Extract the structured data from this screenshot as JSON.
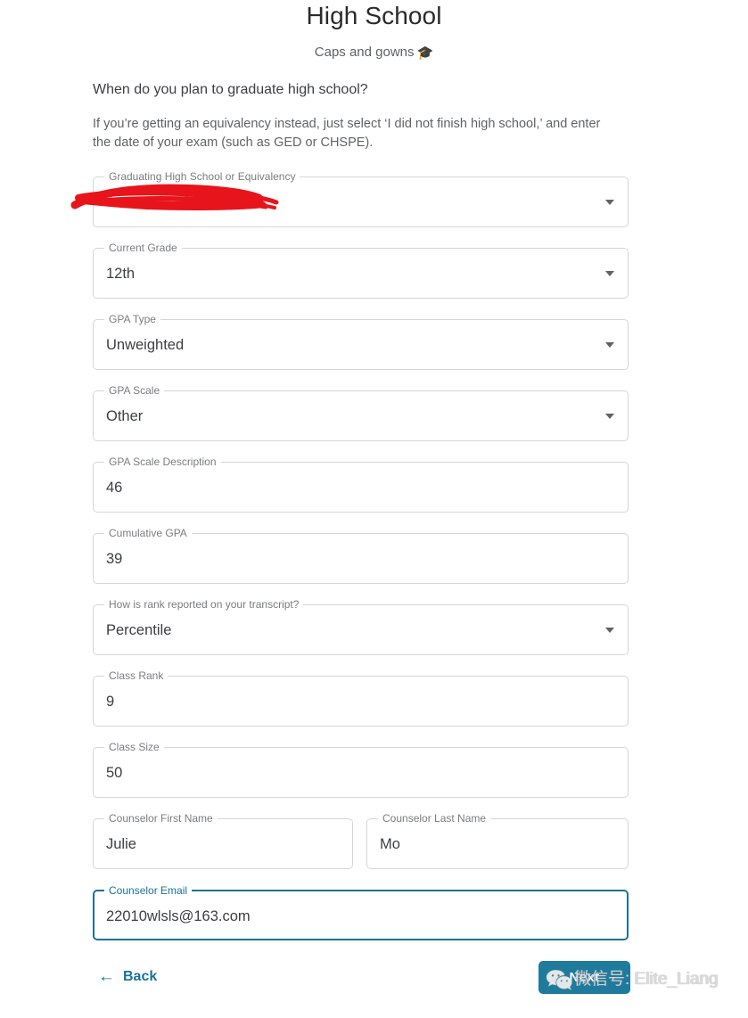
{
  "header": {
    "title": "High School",
    "subtitle": "Caps and gowns",
    "subtitle_emoji": "🎓"
  },
  "intro": {
    "question": "When do you plan to graduate high school?",
    "helper": "If you’re getting an equivalency instead, just select ‘I did not finish high school,’ and enter the date of your exam (such as GED or CHSPE)."
  },
  "fields": {
    "graduating": {
      "label": "Graduating High School or Equivalency",
      "value": "",
      "redacted": true
    },
    "current_grade": {
      "label": "Current Grade",
      "value": "12th"
    },
    "gpa_type": {
      "label": "GPA Type",
      "value": "Unweighted"
    },
    "gpa_scale": {
      "label": "GPA Scale",
      "value": "Other"
    },
    "gpa_scale_description": {
      "label": "GPA Scale Description",
      "value": "46"
    },
    "cumulative_gpa": {
      "label": "Cumulative GPA",
      "value": "39"
    },
    "rank_reported": {
      "label": "How is rank reported on your transcript?",
      "value": "Percentile"
    },
    "class_rank": {
      "label": "Class Rank",
      "value": "9"
    },
    "class_size": {
      "label": "Class Size",
      "value": "50"
    },
    "counselor_first_name": {
      "label": "Counselor First Name",
      "value": "Julie"
    },
    "counselor_last_name": {
      "label": "Counselor Last Name",
      "value": "Mo"
    },
    "counselor_email": {
      "label": "Counselor Email",
      "value": "22010wlsls@163.com",
      "focused": true
    }
  },
  "footer": {
    "back_label": "Back",
    "back_arrow": "←",
    "next_label": "Next"
  },
  "watermark": {
    "text": "微信号: Elite_Liang"
  },
  "colors": {
    "accent": "#1a7298",
    "button": "#1e7b9c",
    "label": "#7a7d80",
    "value": "#3c4043",
    "redaction": "#e8141b"
  }
}
